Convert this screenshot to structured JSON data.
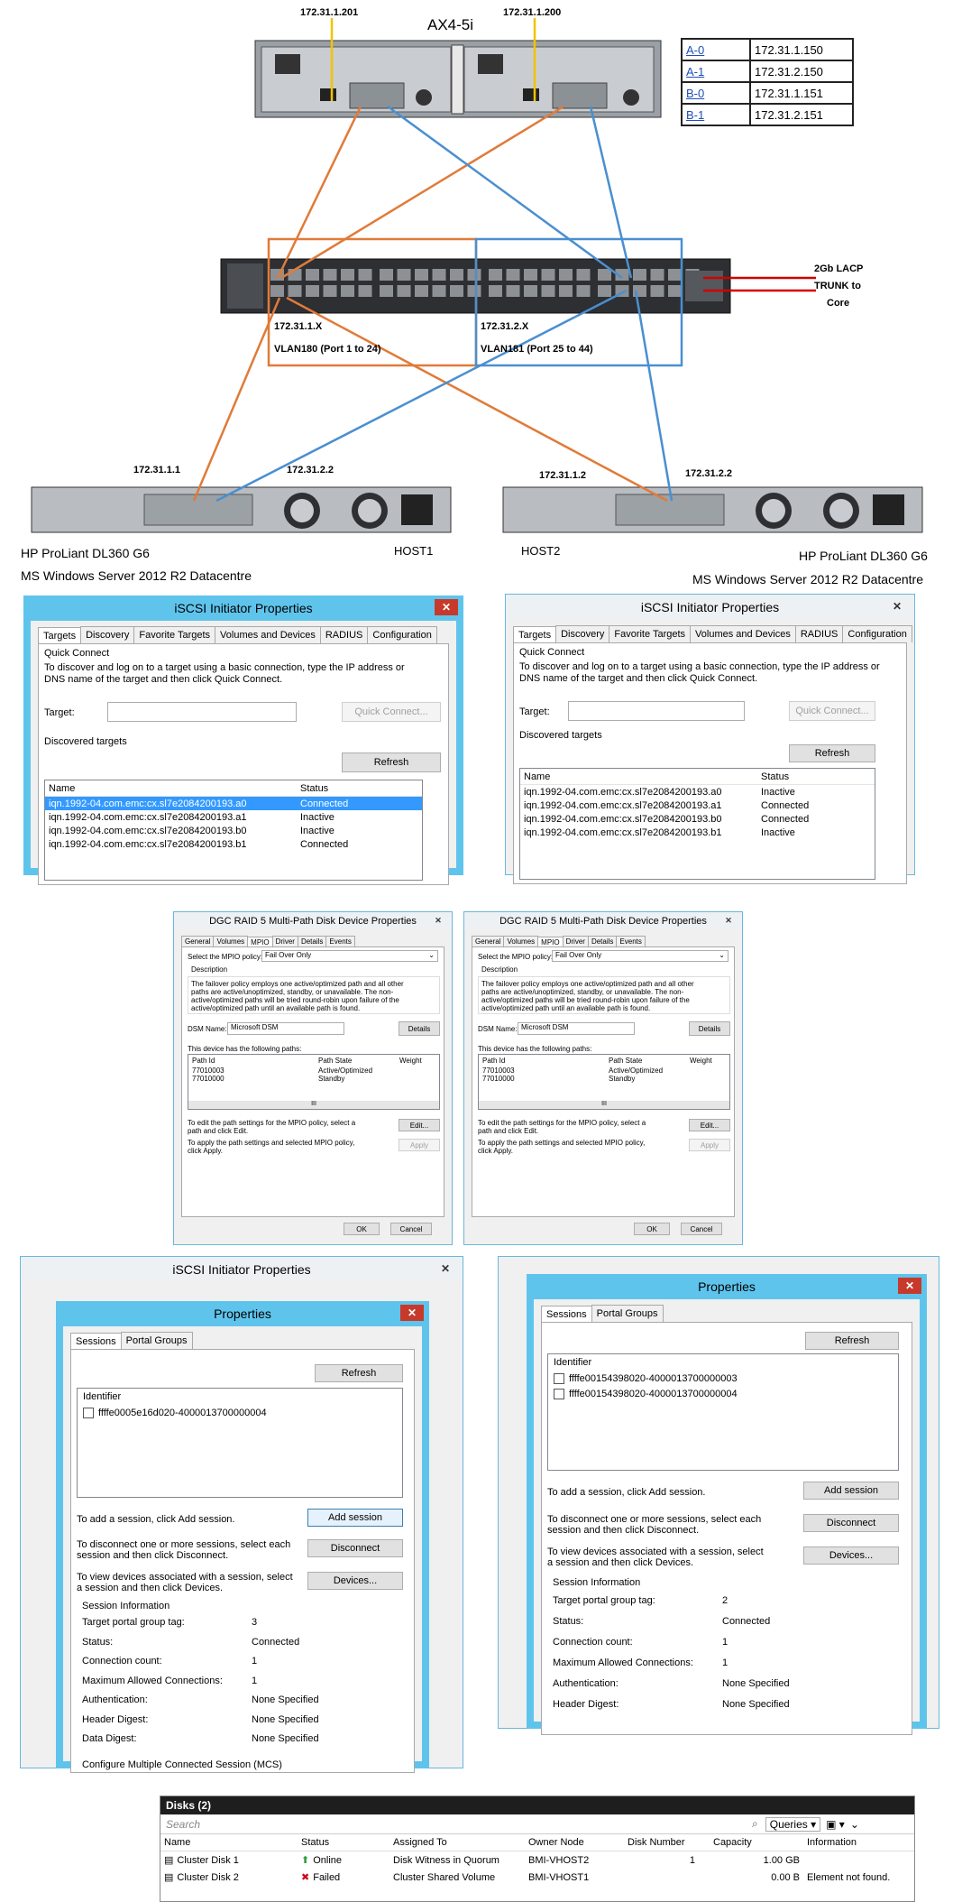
{
  "diagram": {
    "storage_title": "AX4-5i",
    "storage_ip_left": "172.31.1.201",
    "storage_ip_right": "172.31.1.200",
    "ports_table": [
      {
        "port": "A-0",
        "ip": "172.31.1.150"
      },
      {
        "port": "A-1",
        "ip": "172.31.2.150"
      },
      {
        "port": "B-0",
        "ip": "172.31.1.151"
      },
      {
        "port": "B-1",
        "ip": "172.31.2.151"
      }
    ],
    "trunk_label_1": "2Gb LACP",
    "trunk_label_2": "TRUNK to",
    "trunk_label_3": "Core",
    "vlan1_subnet": "172.31.1.X",
    "vlan1_label": "VLAN180 (Port 1 to 24)",
    "vlan2_subnet": "172.31.2.X",
    "vlan2_label": "VLAN181 (Port 25 to 44)",
    "host1_ip_a": "172.31.1.1",
    "host1_ip_b": "172.31.2.2",
    "host2_ip_a": "172.31.1.2",
    "host2_ip_b": "172.31.2.2",
    "host1_model": "HP ProLiant DL360 G6",
    "host1_name": "HOST1",
    "host1_os": "MS Windows Server 2012 R2 Datacentre",
    "host2_name": "HOST2",
    "host2_model": "HP ProLiant DL360 G6",
    "host2_os": "MS Windows Server 2012 R2 Datacentre",
    "colors": {
      "orange": "#e07b39",
      "blue": "#4a8fd0",
      "yellow": "#f2c300",
      "red": "#d00000"
    }
  },
  "iscsi": {
    "title": "iSCSI Initiator Properties",
    "tabs": [
      "Targets",
      "Discovery",
      "Favorite Targets",
      "Volumes and Devices",
      "RADIUS",
      "Configuration"
    ],
    "quick_connect": "Quick Connect",
    "qc_desc_1": "To discover and log on to a target using a basic connection, type the IP address or",
    "qc_desc_2": "DNS name of the target and then click Quick Connect.",
    "target_label": "Target:",
    "quick_connect_button": "Quick Connect...",
    "discovered": "Discovered targets",
    "refresh": "Refresh",
    "col_name": "Name",
    "col_status": "Status",
    "host1_targets": [
      {
        "name": "iqn.1992-04.com.emc:cx.sl7e2084200193.a0",
        "status": "Connected"
      },
      {
        "name": "iqn.1992-04.com.emc:cx.sl7e2084200193.a1",
        "status": "Inactive"
      },
      {
        "name": "iqn.1992-04.com.emc:cx.sl7e2084200193.b0",
        "status": "Inactive"
      },
      {
        "name": "iqn.1992-04.com.emc:cx.sl7e2084200193.b1",
        "status": "Connected"
      }
    ],
    "host2_targets": [
      {
        "name": "iqn.1992-04.com.emc:cx.sl7e2084200193.a0",
        "status": "Inactive"
      },
      {
        "name": "iqn.1992-04.com.emc:cx.sl7e2084200193.a1",
        "status": "Connected"
      },
      {
        "name": "iqn.1992-04.com.emc:cx.sl7e2084200193.b0",
        "status": "Connected"
      },
      {
        "name": "iqn.1992-04.com.emc:cx.sl7e2084200193.b1",
        "status": "Inactive"
      }
    ]
  },
  "mpio": {
    "title": "DGC RAID 5  Multi-Path Disk Device Properties",
    "tabs": [
      "General",
      "Volumes",
      "MPIO",
      "Driver",
      "Details",
      "Events"
    ],
    "policy_label": "Select the MPIO policy:",
    "policy_value": "Fail Over Only",
    "description_label": "Description",
    "desc_1": "The failover policy employs one active/optimized path and all other",
    "desc_2": "paths are active/unoptimized, standby, or unavailable.  The non-",
    "desc_3": "active/optimized paths will be tried round-robin upon failure of the",
    "desc_4": "active/optimized path until an available path is found.",
    "dsm_label": "DSM Name:",
    "dsm_value": "Microsoft DSM",
    "details": "Details",
    "paths_label": "This device has the following paths:",
    "col_path": "Path Id",
    "col_state": "Path State",
    "col_weight": "Weight",
    "paths": [
      {
        "id": "77010003",
        "state": "Active/Optimized"
      },
      {
        "id": "77010000",
        "state": "Standby"
      }
    ],
    "scroll_marker": "III",
    "edit_text_1": "To edit the path settings for the MPIO policy, select a",
    "edit_text_2": "path and click Edit.",
    "edit": "Edit...",
    "apply_text_1": "To apply the path settings and selected MPIO policy,",
    "apply_text_2": "click Apply.",
    "apply": "Apply",
    "ok": "OK",
    "cancel": "Cancel"
  },
  "sessions": {
    "title": "Properties",
    "bg_title": "iSCSI Initiator Properties",
    "tabs": [
      "Sessions",
      "Portal Groups"
    ],
    "refresh": "Refresh",
    "identifier": "Identifier",
    "host1_ids": [
      "ffffe0005e16d020-4000013700000004"
    ],
    "host2_ids": [
      "ffffe00154398020-4000013700000003",
      "ffffe00154398020-4000013700000004"
    ],
    "add_text": "To add a session, click Add session.",
    "add": "Add session",
    "disc_text_1": "To disconnect one or more sessions, select each",
    "disc_text_2": "session and then click Disconnect.",
    "disconnect": "Disconnect",
    "dev_text_1": "To view devices associated with a session, select",
    "dev_text_2": "a session and then click Devices.",
    "devices": "Devices...",
    "info": "Session Information",
    "labels": [
      "Target portal group tag:",
      "Status:",
      "Connection count:",
      "Maximum Allowed Connections:",
      "Authentication:",
      "Header Digest:",
      "Data Digest:"
    ],
    "host1_values": [
      "3",
      "Connected",
      "1",
      "1",
      "None Specified",
      "None Specified",
      "None Specified"
    ],
    "host2_values": [
      "2",
      "Connected",
      "1",
      "1",
      "None Specified",
      "None Specified"
    ],
    "mcs": "Configure Multiple Connected Session (MCS)"
  },
  "disks": {
    "title": "Disks (2)",
    "search": "Search",
    "queries": "Queries",
    "columns": [
      "Name",
      "Status",
      "Assigned To",
      "Owner Node",
      "Disk Number",
      "Capacity",
      "Information"
    ],
    "rows": [
      {
        "name": "Cluster Disk 1",
        "status": "Online",
        "assigned": "Disk Witness in Quorum",
        "owner": "BMI-VHOST2",
        "number": "1",
        "capacity": "1.00 GB",
        "info": ""
      },
      {
        "name": "Cluster Disk 2",
        "status": "Failed",
        "assigned": "Cluster Shared Volume",
        "owner": "BMI-VHOST1",
        "number": "",
        "capacity": "0.00 B",
        "info": "Element not found."
      }
    ]
  }
}
